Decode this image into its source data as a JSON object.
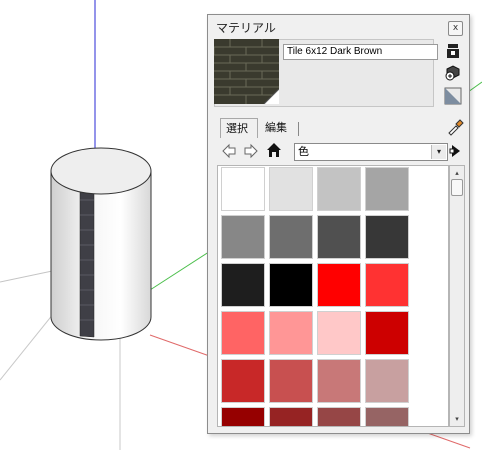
{
  "window": {
    "title": "マテリアル",
    "close_glyph": "x"
  },
  "material": {
    "name": "Tile 6x12 Dark Brown"
  },
  "tabs": [
    {
      "label": "選択",
      "active": true
    },
    {
      "label": "編集",
      "active": false
    }
  ],
  "collection": {
    "selected": "色",
    "arrow_glyph": "▾"
  },
  "scrollbar": {
    "up_glyph": "▴",
    "down_glyph": "▾"
  },
  "swatch_colors": [
    "#ffffff",
    "#e1e1e1",
    "#c3c3c3",
    "#a5a5a5",
    "#878787",
    "#6e6e6e",
    "#505050",
    "#373737",
    "#1e1e1e",
    "#000000",
    "#ff0000",
    "#ff3232",
    "#ff6464",
    "#ff9696",
    "#ffc8c8",
    "#cd0000",
    "#c82828",
    "#c85050",
    "#c87878",
    "#c8a0a0",
    "#960000",
    "#962323",
    "#964646",
    "#966464"
  ],
  "icons": {
    "model_materials": "model-materials-icon",
    "create_material": "create-material-icon",
    "default_material": "default-material-icon",
    "sample_paint": "eyedropper-icon",
    "back": "back-arrow-icon",
    "forward": "forward-arrow-icon",
    "home": "home-icon",
    "details": "details-arrow-icon"
  }
}
